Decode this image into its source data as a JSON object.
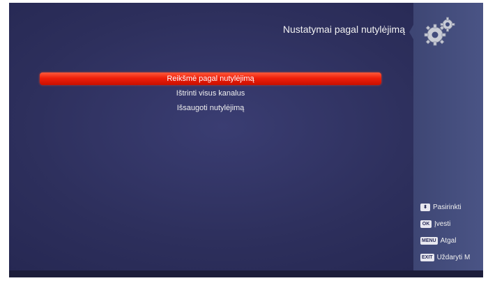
{
  "header": {
    "title": "Nustatymai pagal nutylėjimą"
  },
  "menu": {
    "items": [
      {
        "label": "Reikšmė pagal nutylėjimą",
        "selected": true
      },
      {
        "label": "Ištrinti visus kanalus",
        "selected": false
      },
      {
        "label": "Išsaugoti nutylėjimą",
        "selected": false
      }
    ]
  },
  "sidebar": {
    "icon": "gear-icon",
    "hints": [
      {
        "key": "⬍",
        "label": "Pasirinkti"
      },
      {
        "key": "OK",
        "label": "Įvesti"
      },
      {
        "key": "MENU",
        "label": "Atgal"
      },
      {
        "key": "EXIT",
        "label": "Uždaryti M"
      }
    ]
  },
  "colors": {
    "background": "#2d2f5c",
    "panel": "#424c7c",
    "selection": "#ef1f0b",
    "text": "#f0f0f0"
  }
}
